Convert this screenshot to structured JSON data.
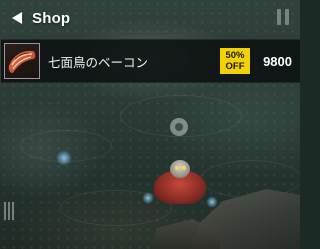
{
  "header": {
    "title": "Shop",
    "back_icon": "back-arrow-icon"
  },
  "items": [
    {
      "name": "七面鳥のベーコン",
      "icon": "bacon-icon",
      "discount_line1": "50%",
      "discount_line2": "OFF",
      "price": "9800"
    }
  ],
  "colors": {
    "badge": "#f2d200",
    "row_background": "#0a0e0d",
    "text": "#ffffff"
  }
}
